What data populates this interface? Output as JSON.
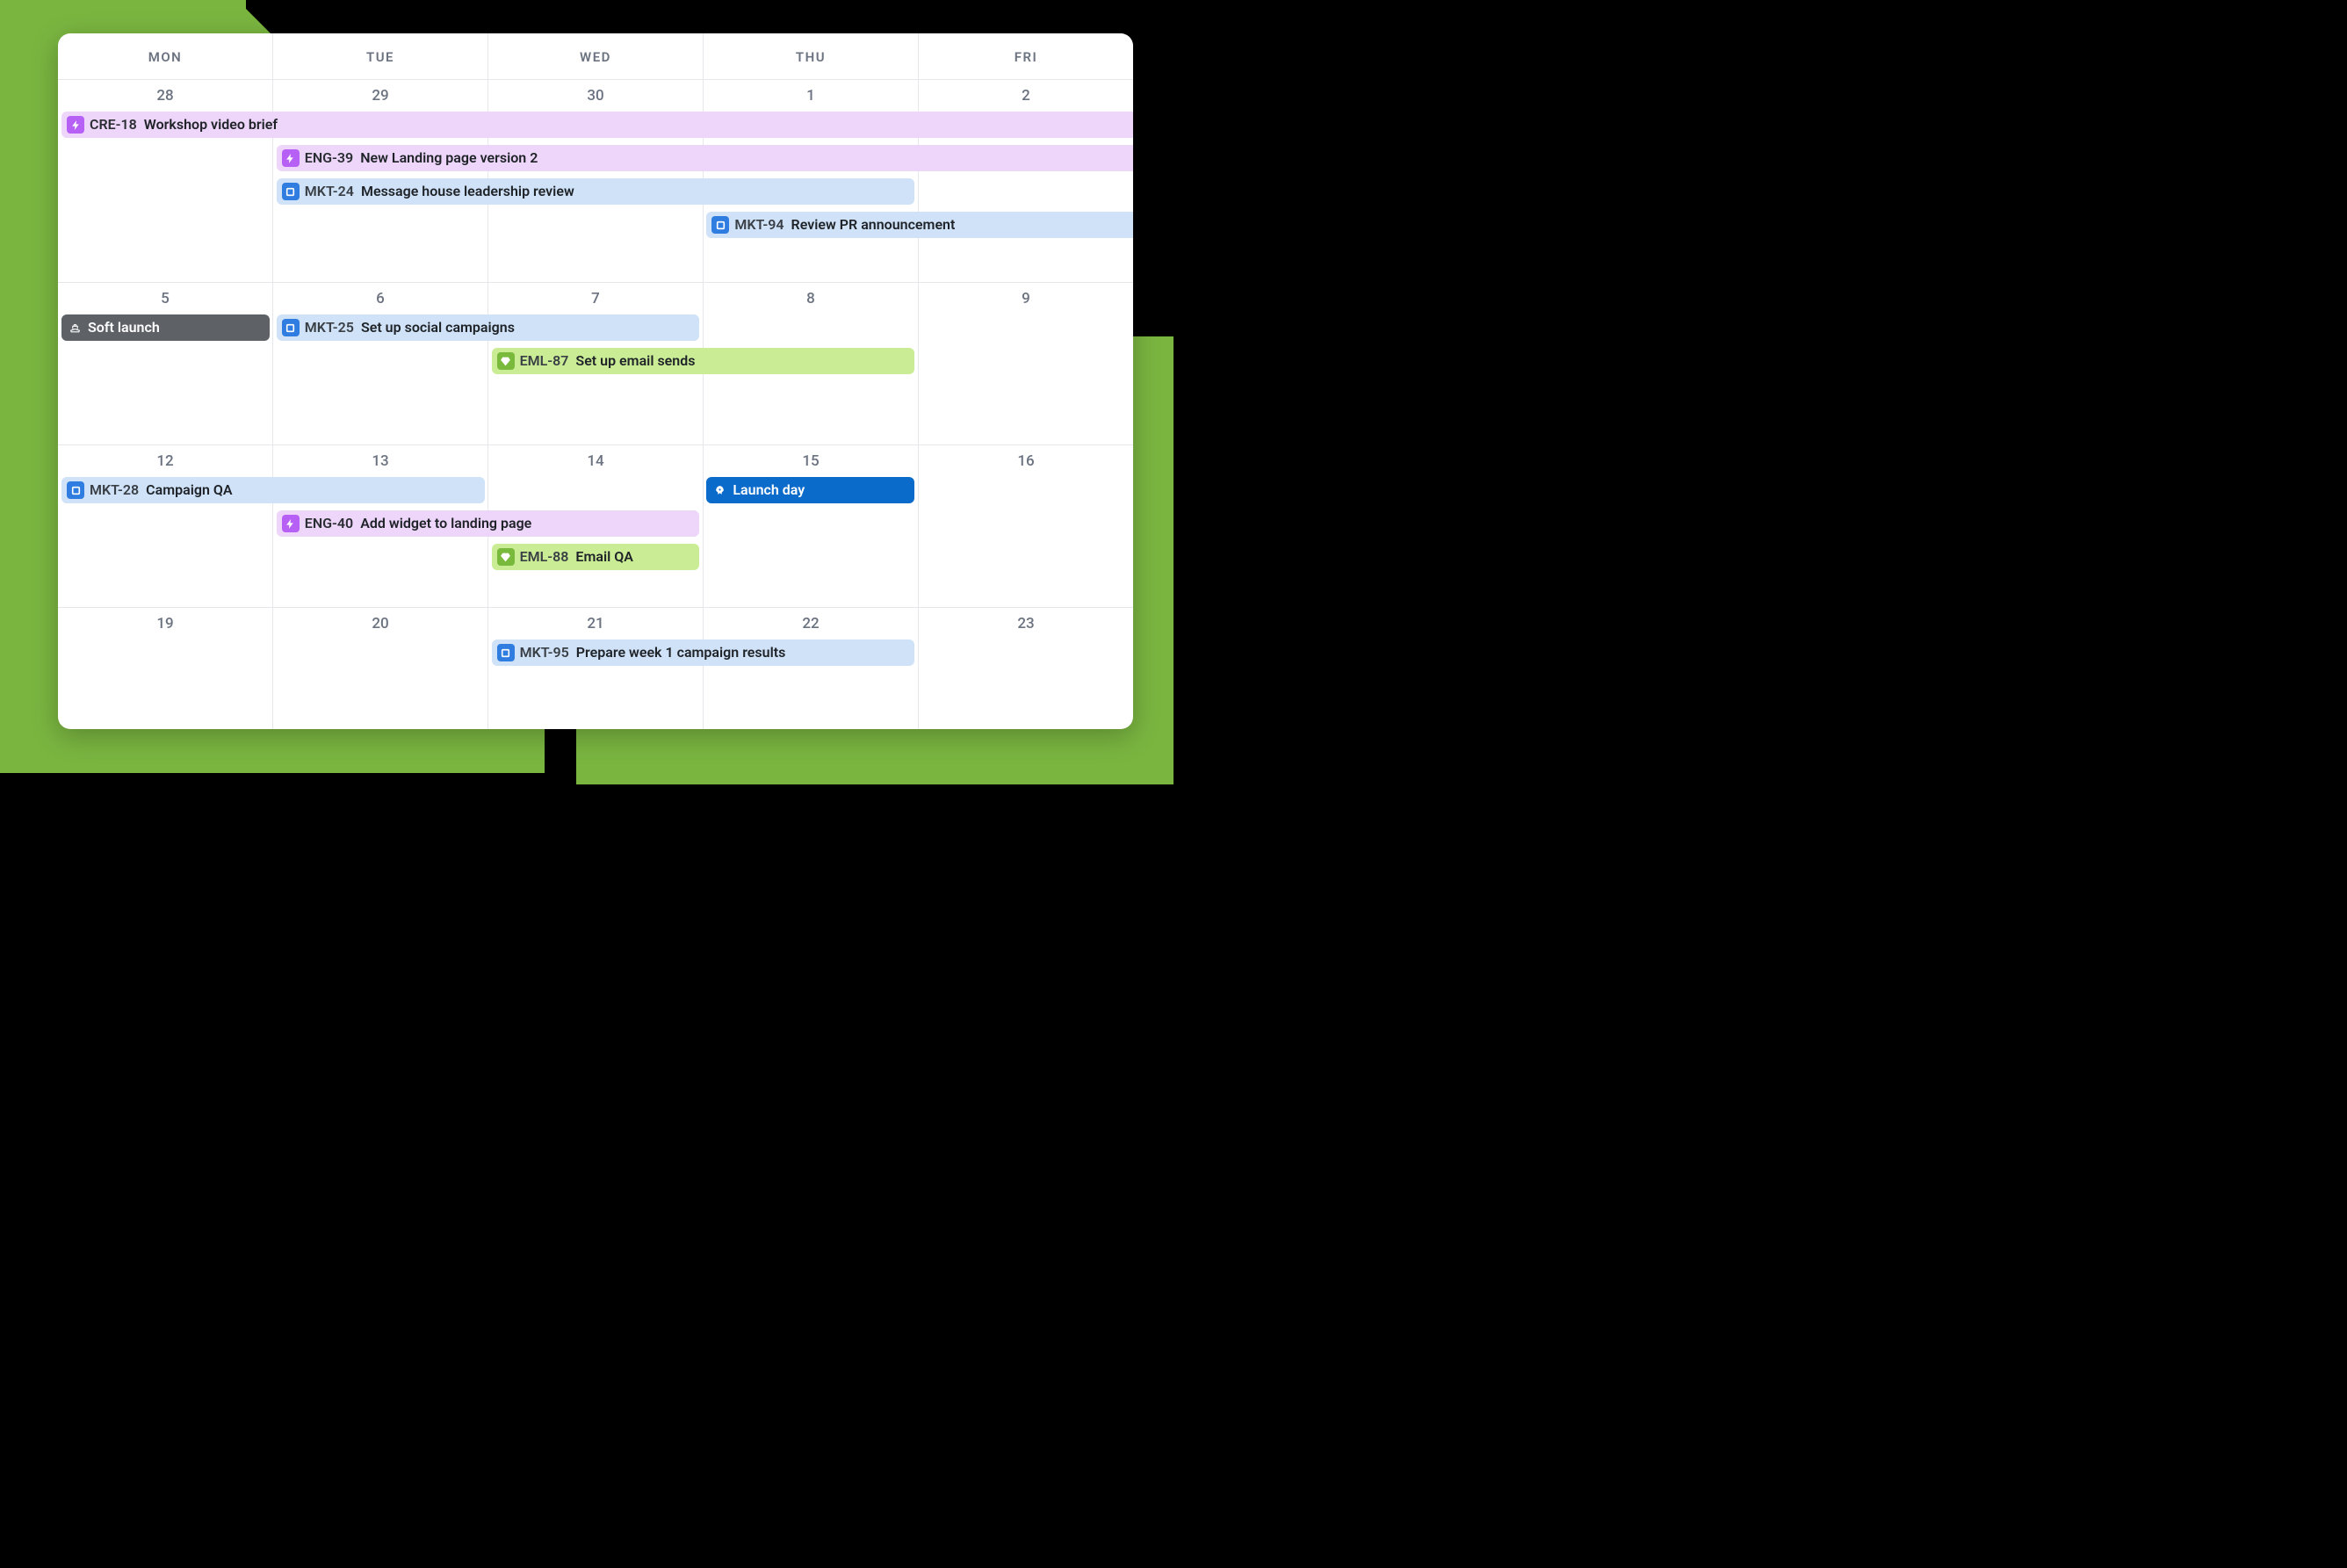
{
  "header": {
    "days": [
      "MON",
      "TUE",
      "WED",
      "THU",
      "FRI"
    ]
  },
  "weeks": [
    {
      "dates": [
        "28",
        "29",
        "30",
        "1",
        "2"
      ],
      "events": [
        {
          "id": "cre18",
          "icon": "bolt",
          "key": "CRE-18",
          "title": "Workshop video brief",
          "color": "purple",
          "start": 0,
          "span": 5,
          "row": 0,
          "openEnd": true
        },
        {
          "id": "eng39",
          "icon": "bolt",
          "key": "ENG-39",
          "title": "New Landing page version 2",
          "color": "purple",
          "start": 1,
          "span": 4,
          "row": 1,
          "openEnd": true
        },
        {
          "id": "mkt24",
          "icon": "box",
          "key": "MKT-24",
          "title": "Message house leadership review",
          "color": "blue",
          "start": 1,
          "span": 3,
          "row": 2
        },
        {
          "id": "mkt94",
          "icon": "box",
          "key": "MKT-94",
          "title": "Review PR announcement",
          "color": "blue",
          "start": 3,
          "span": 2,
          "row": 3,
          "openEnd": true
        }
      ]
    },
    {
      "dates": [
        "5",
        "6",
        "7",
        "8",
        "9"
      ],
      "events": [
        {
          "id": "soft",
          "icon": "ship",
          "key": "",
          "title": "Soft launch",
          "color": "dark",
          "start": 0,
          "span": 1,
          "row": 0
        },
        {
          "id": "mkt25",
          "icon": "box",
          "key": "MKT-25",
          "title": "Set up social campaigns",
          "color": "blue",
          "start": 1,
          "span": 2,
          "row": 0
        },
        {
          "id": "eml87",
          "icon": "gem",
          "key": "EML-87",
          "title": "Set up email sends",
          "color": "green",
          "start": 2,
          "span": 2,
          "row": 1
        }
      ]
    },
    {
      "dates": [
        "12",
        "13",
        "14",
        "15",
        "16"
      ],
      "events": [
        {
          "id": "mkt28",
          "icon": "box",
          "key": "MKT-28",
          "title": "Campaign QA",
          "color": "blue",
          "start": 0,
          "span": 2,
          "row": 0
        },
        {
          "id": "launch",
          "icon": "rocket",
          "key": "",
          "title": "Launch day",
          "color": "bright",
          "start": 3,
          "span": 1,
          "row": 0
        },
        {
          "id": "eng40",
          "icon": "bolt",
          "key": "ENG-40",
          "title": "Add widget to landing page",
          "color": "purple",
          "start": 1,
          "span": 2,
          "row": 1
        },
        {
          "id": "eml88",
          "icon": "gem",
          "key": "EML-88",
          "title": "Email QA",
          "color": "green",
          "start": 2,
          "span": 1,
          "row": 2
        }
      ]
    },
    {
      "dates": [
        "19",
        "20",
        "21",
        "22",
        "23"
      ],
      "events": [
        {
          "id": "mkt95",
          "icon": "box",
          "key": "MKT-95",
          "title": "Prepare week 1 campaign results",
          "color": "blue",
          "start": 2,
          "span": 2,
          "row": 0
        }
      ]
    }
  ]
}
